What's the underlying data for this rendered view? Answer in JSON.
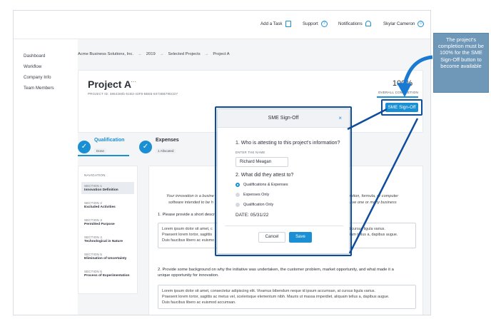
{
  "topbar": {
    "add_task": "Add a Task",
    "support": "Support",
    "notifications": "Notifications",
    "user": "Skylar Cameron"
  },
  "sidebar": {
    "items": [
      "Dashboard",
      "Workflow",
      "Company Info",
      "Team Members"
    ]
  },
  "breadcrumb": [
    "Acme Business Solutions, Inc.",
    "2019",
    "Selected Projects",
    "Project A"
  ],
  "project": {
    "title": "Project A",
    "menu_dots": "···",
    "id_text": "PROJECT ID: 3864360b-51B3-43F8-BB65-6073BB795CD7",
    "completion": "100%",
    "completion_label": "OVERALL COMPLETION",
    "sme_button": "SME Sign-Off"
  },
  "steps": [
    {
      "title": "Qualification",
      "badge": "Done"
    },
    {
      "title": "Expenses",
      "badge": "1 Allocated"
    }
  ],
  "navigation": {
    "header": "NAVIGATION",
    "sections": [
      {
        "num": "SECTION 1",
        "name": "Innovation Definition"
      },
      {
        "num": "SECTION 2",
        "name": "Excluded Activities"
      },
      {
        "num": "SECTION 3",
        "name": "Permitted Purpose"
      },
      {
        "num": "SECTION 4",
        "name": "Technological in Nature"
      },
      {
        "num": "SECTION 5",
        "name": "Elimination of Uncertainty"
      },
      {
        "num": "SECTION 6",
        "name": "Process of Experimentation"
      }
    ]
  },
  "content": {
    "intro_line1_left": "Your innovation is a busine",
    "intro_line1_right": "invention, formula, or computer",
    "intro_line2_left": "software intended to be h",
    "intro_line2_right": "m have one or many business",
    "q1": "1. Please provide a short descri",
    "a1_line1_left": "Lorem ipsum dolor sit amet, c",
    "a1_line1_right": "m, at cursus ligula varius.",
    "a1_line2_left": "Praesent lorem tortor, sagittis",
    "a1_line2_right": "liam tellus a, dapibus augue.",
    "a1_line3_left": "Duis faucibus libero ac euismo",
    "q2_line1": "2. Provide some background on why the initiative was undertaken, the customer problem, market opportunity, and what made it a",
    "q2_line2": "unique opportunity for innovation.",
    "a2_line1": "Lorem ipsum dolor sit amet, consectetur adipiscing elit. Vivamus bibendum neque id ipsum accumsan, at cursus ligula varius.",
    "a2_line2": "Praesent lorem tortor, sagittis ac metus vel, scelerisque elementum nibh. Mauris ut massa imperdiet, aliquam tellus a, dapibus augue.",
    "a2_line3": "Duis faucibus libero ac euismod accumsan."
  },
  "modal": {
    "title": "SME Sign-Off",
    "close": "×",
    "q1": "1. Who is attesting to this project's information?",
    "name_label": "ENTER THE NAME",
    "name_value": "Richard Meagan",
    "q2": "2. What did they attest to?",
    "options": [
      "Qualifications & Expenses",
      "Expenses Only",
      "Qualification Only"
    ],
    "selected_index": 0,
    "date": "DATE: 05/31/22",
    "cancel": "Cancel",
    "save": "Save"
  },
  "callout": {
    "text": "The project's completion must be 100% for the SME Sign-Off button to become available"
  },
  "colors": {
    "accent": "#1a8fd3",
    "highlight_outline": "#0d4d9a",
    "callout_bg": "#6f98b8"
  }
}
